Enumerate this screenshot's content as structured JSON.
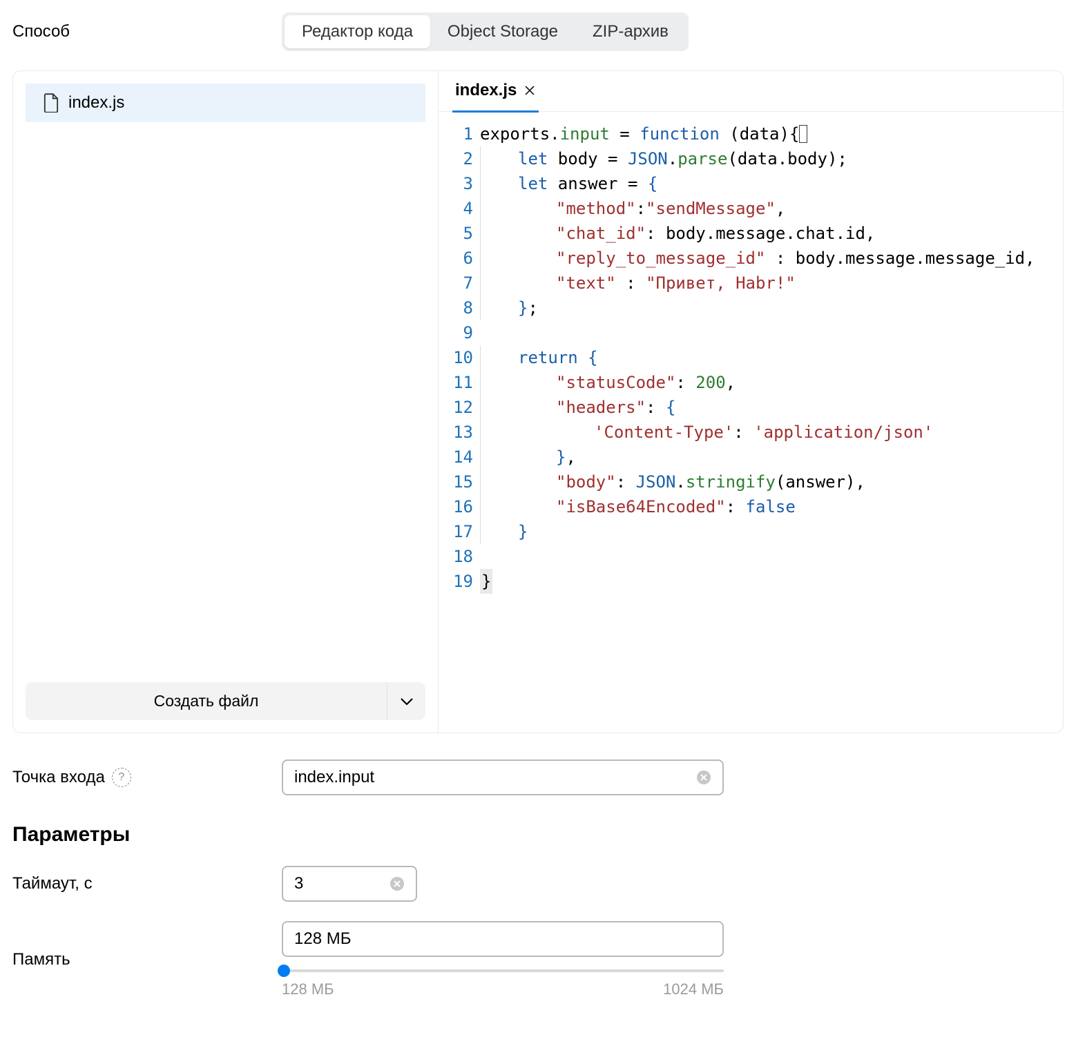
{
  "method": {
    "label": "Способ",
    "options": [
      "Редактор кода",
      "Object Storage",
      "ZIP-архив"
    ],
    "active_index": 0
  },
  "files": {
    "items": [
      "index.js"
    ],
    "create_label": "Создать файл"
  },
  "editor": {
    "tab_label": "index.js",
    "code_lines": [
      [
        {
          "t": "default",
          "v": "exports."
        },
        {
          "t": "green",
          "v": "input"
        },
        {
          "t": "default",
          "v": " = "
        },
        {
          "t": "kw",
          "v": "function"
        },
        {
          "t": "default",
          "v": " (data){"
        }
      ],
      [
        {
          "indent": 1
        },
        {
          "t": "kw",
          "v": "let"
        },
        {
          "t": "default",
          "v": " body = "
        },
        {
          "t": "kw",
          "v": "JSON"
        },
        {
          "t": "default",
          "v": "."
        },
        {
          "t": "green",
          "v": "parse"
        },
        {
          "t": "default",
          "v": "(data.body);"
        }
      ],
      [
        {
          "indent": 1
        },
        {
          "t": "kw",
          "v": "let"
        },
        {
          "t": "default",
          "v": " answer = "
        },
        {
          "t": "kw",
          "v": "{"
        }
      ],
      [
        {
          "indent": 2
        },
        {
          "t": "str",
          "v": "\"method\""
        },
        {
          "t": "default",
          "v": ":"
        },
        {
          "t": "str",
          "v": "\"sendMessage\""
        },
        {
          "t": "default",
          "v": ","
        }
      ],
      [
        {
          "indent": 2
        },
        {
          "t": "str",
          "v": "\"chat_id\""
        },
        {
          "t": "default",
          "v": ": body.message.chat.id,"
        }
      ],
      [
        {
          "indent": 2
        },
        {
          "t": "str",
          "v": "\"reply_to_message_id\""
        },
        {
          "t": "default",
          "v": " : body.message.message_id,"
        }
      ],
      [
        {
          "indent": 2
        },
        {
          "t": "str",
          "v": "\"text\""
        },
        {
          "t": "default",
          "v": " : "
        },
        {
          "t": "str",
          "v": "\"Привет, Habr!\""
        }
      ],
      [
        {
          "indent": 1
        },
        {
          "t": "kw",
          "v": "}"
        },
        {
          "t": "default",
          "v": ";"
        }
      ],
      [],
      [
        {
          "indent": 1
        },
        {
          "t": "kw",
          "v": "return"
        },
        {
          "t": "default",
          "v": " "
        },
        {
          "t": "kw",
          "v": "{"
        }
      ],
      [
        {
          "indent": 2
        },
        {
          "t": "str",
          "v": "\"statusCode\""
        },
        {
          "t": "default",
          "v": ": "
        },
        {
          "t": "num",
          "v": "200"
        },
        {
          "t": "default",
          "v": ","
        }
      ],
      [
        {
          "indent": 2
        },
        {
          "t": "str",
          "v": "\"headers\""
        },
        {
          "t": "default",
          "v": ": "
        },
        {
          "t": "kw",
          "v": "{"
        }
      ],
      [
        {
          "indent": 3
        },
        {
          "t": "str",
          "v": "'Content-Type'"
        },
        {
          "t": "default",
          "v": ": "
        },
        {
          "t": "str",
          "v": "'application/json'"
        }
      ],
      [
        {
          "indent": 2
        },
        {
          "t": "kw",
          "v": "}"
        },
        {
          "t": "default",
          "v": ","
        }
      ],
      [
        {
          "indent": 2
        },
        {
          "t": "str",
          "v": "\"body\""
        },
        {
          "t": "default",
          "v": ": "
        },
        {
          "t": "kw",
          "v": "JSON"
        },
        {
          "t": "default",
          "v": "."
        },
        {
          "t": "green",
          "v": "stringify"
        },
        {
          "t": "default",
          "v": "(answer),"
        }
      ],
      [
        {
          "indent": 2
        },
        {
          "t": "str",
          "v": "\"isBase64Encoded\""
        },
        {
          "t": "default",
          "v": ": "
        },
        {
          "t": "kw",
          "v": "false"
        }
      ],
      [
        {
          "indent": 1
        },
        {
          "t": "kw",
          "v": "}"
        }
      ],
      [],
      [
        {
          "t": "kw",
          "v": "}",
          "last_brace": true
        }
      ]
    ]
  },
  "entry_point": {
    "label": "Точка входа",
    "value": "index.input"
  },
  "params_heading": "Параметры",
  "timeout": {
    "label": "Таймаут, с",
    "value": "3"
  },
  "memory": {
    "label": "Память",
    "value": "128 МБ",
    "min_label": "128 МБ",
    "max_label": "1024 МБ"
  }
}
